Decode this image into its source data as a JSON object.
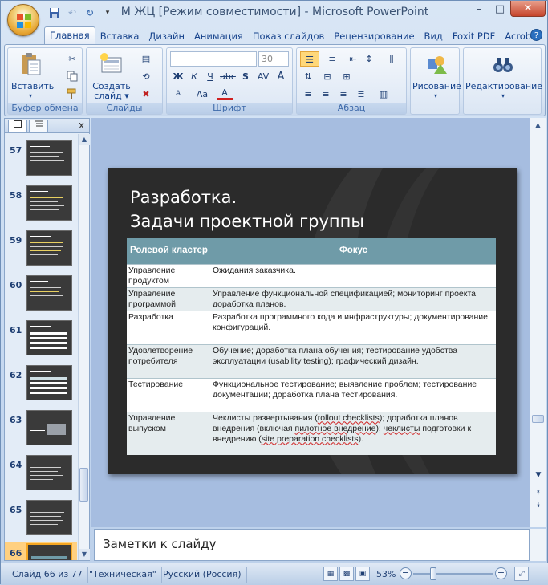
{
  "window": {
    "title": "М ЖЦ [Режим совместимости] - Microsoft PowerPoint"
  },
  "qat": {
    "save": "save-icon",
    "undo": "undo-icon",
    "redo": "redo-icon",
    "more": "▾"
  },
  "window_controls": {
    "minimize": "–",
    "maximize": "□",
    "close": "✕"
  },
  "tabs": [
    "Главная",
    "Вставка",
    "Дизайн",
    "Анимация",
    "Показ слайдов",
    "Рецензирование",
    "Вид",
    "Foxit PDF",
    "Acrobat"
  ],
  "help": "?",
  "ribbon": {
    "clipboard": {
      "label": "Буфер обмена",
      "paste": "Вставить"
    },
    "slides": {
      "label": "Слайды",
      "new_slide_line1": "Создать",
      "new_slide_line2": "слайд ▾"
    },
    "font": {
      "label": "Шрифт",
      "font_name": "",
      "font_size": "30",
      "bold": "Ж",
      "italic": "К",
      "underline": "Ч",
      "strike": "abc",
      "shadow": "S",
      "spacing": "AV",
      "case": "Aa",
      "color": "A",
      "grow": "A",
      "shrink": "A"
    },
    "paragraph": {
      "label": "Абзац"
    },
    "drawing": {
      "label": "Рисование"
    },
    "editing": {
      "label": "Редактирование"
    }
  },
  "slides_panel": {
    "close": "x",
    "thumbnails": [
      {
        "num": "57"
      },
      {
        "num": "58"
      },
      {
        "num": "59"
      },
      {
        "num": "60"
      },
      {
        "num": "61"
      },
      {
        "num": "62"
      },
      {
        "num": "63"
      },
      {
        "num": "64"
      },
      {
        "num": "65"
      },
      {
        "num": "66"
      }
    ]
  },
  "slide": {
    "title_line1": "Разработка.",
    "title_line2": "Задачи проектной группы",
    "table": {
      "headers": [
        "Ролевой кластер",
        "Фокус"
      ],
      "rows": [
        {
          "cluster": "Управление продуктом",
          "focus": "Ожидания заказчика."
        },
        {
          "cluster": "Управление программой",
          "focus": "Управление функциональной спецификацией; мониторинг проекта; доработка планов."
        },
        {
          "cluster": "Разработка",
          "focus": "Разработка программного кода и инфраструктуры; документирование конфигураций."
        },
        {
          "cluster": "Удовлетворение потребителя",
          "focus": "Обучение; доработка плана обучения; тестирование удобства эксплуатации (usability testing); графический дизайн."
        },
        {
          "cluster": "Тестирование",
          "focus": "Функциональное тестирование; выявление проблем; тестирование документации; доработка плана тестирования."
        },
        {
          "cluster": "Управление выпуском",
          "focus_a": "Чеклисты развертывания (",
          "focus_b": "rollout checklists",
          "focus_c": "); доработка планов внедрения (включая ",
          "focus_d": "пилотное внедрение",
          "focus_e": "); ",
          "focus_f": "чеклисты",
          "focus_g": " подготовки к внедрению (",
          "focus_h": "site preparation checklists",
          "focus_i": ")."
        }
      ]
    }
  },
  "notes": {
    "placeholder": "Заметки к слайду"
  },
  "status": {
    "slide": "Слайд 66 из 77",
    "theme": "\"Техническая\"",
    "language": "Русский (Россия)",
    "zoom": "53%"
  }
}
